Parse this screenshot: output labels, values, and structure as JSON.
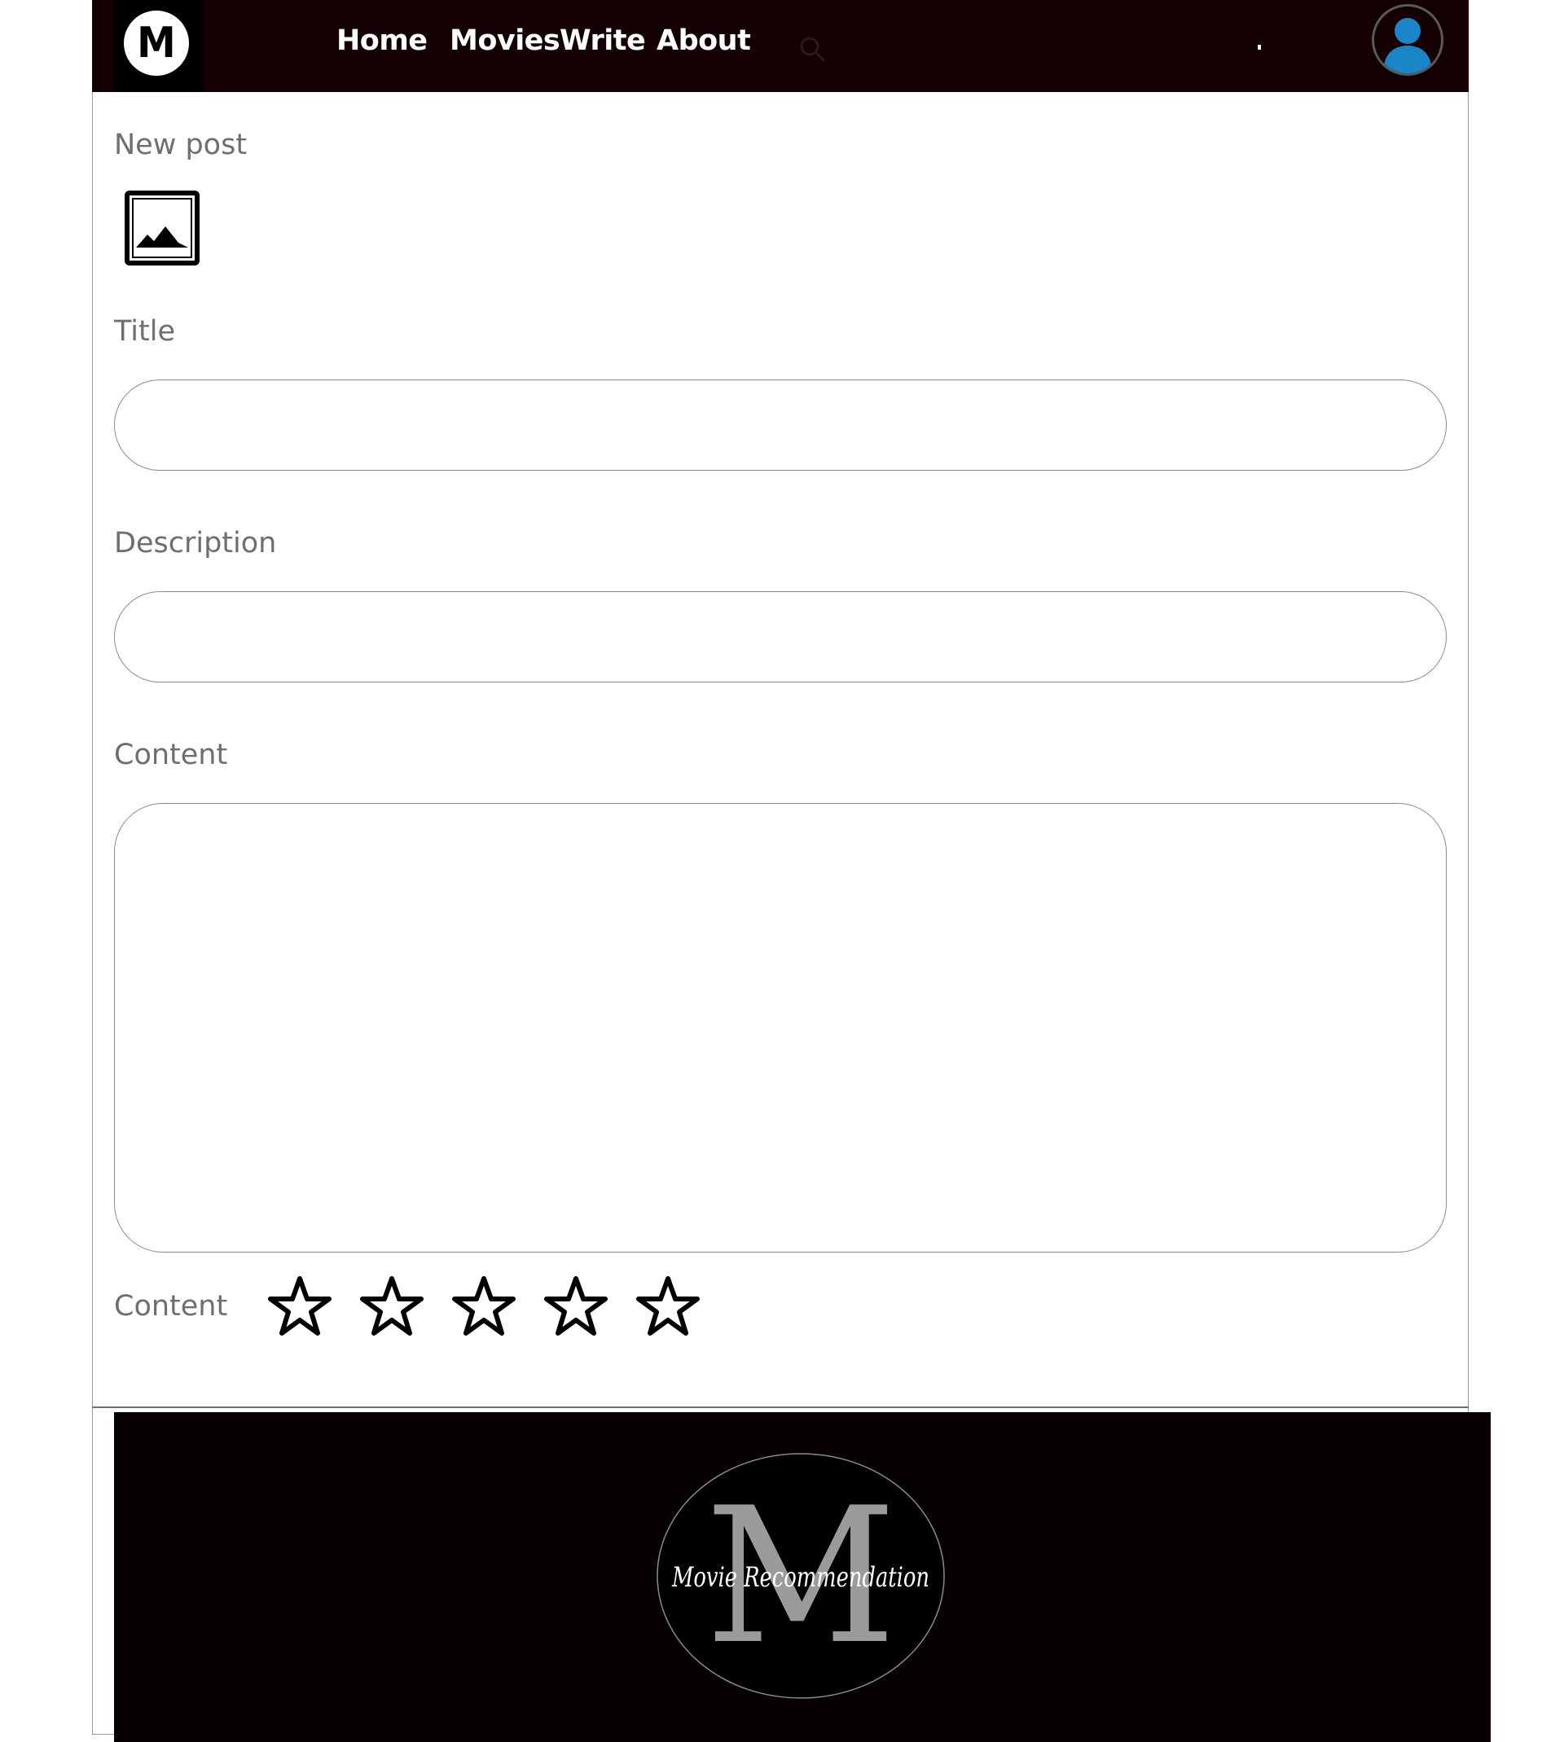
{
  "header": {
    "logo_letter": "M",
    "nav": [
      "Home",
      "Movies",
      "Write",
      "About"
    ],
    "search_icon": "search-icon",
    "avatar_icon": "user-avatar-icon",
    "colors": {
      "bar": "#140002",
      "avatar": "#1a86c7"
    }
  },
  "form": {
    "heading": "New post",
    "image_icon": "image-icon",
    "title_label": "Title",
    "title_value": "",
    "description_label": "Description",
    "description_value": "",
    "content_label": "Content",
    "content_value": "",
    "rating_label": "Content",
    "rating": {
      "value": 0,
      "max": 5,
      "icon": "star-outline-icon"
    }
  },
  "footer": {
    "brand_letter": "M",
    "brand_script": "Movie Recommendation",
    "colors": {
      "background": "#070001",
      "letter": "#9b9b9b"
    }
  }
}
